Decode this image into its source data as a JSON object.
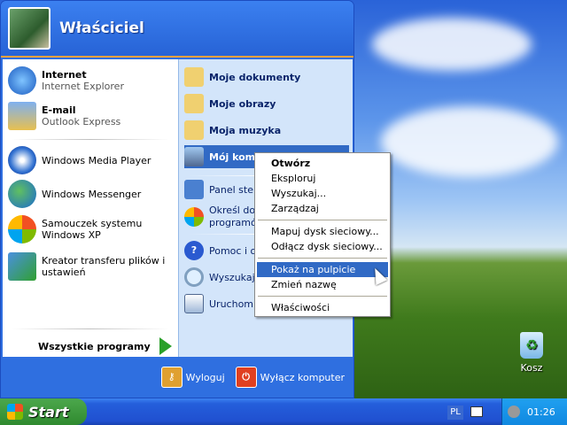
{
  "user": {
    "name": "Właściciel"
  },
  "left": [
    {
      "title": "Internet",
      "sub": "Internet Explorer",
      "icon": "internet-explorer-icon"
    },
    {
      "title": "E-mail",
      "sub": "Outlook Express",
      "icon": "outlook-express-icon"
    },
    {
      "label": "Windows Media Player",
      "icon": "media-player-icon"
    },
    {
      "label": "Windows Messenger",
      "icon": "messenger-icon"
    },
    {
      "label": "Samouczek systemu Windows XP",
      "icon": "tour-icon"
    },
    {
      "label": "Kreator transferu plików i ustawień",
      "icon": "transfer-wizard-icon"
    }
  ],
  "all_programs": "Wszystkie programy",
  "right": [
    {
      "label": "Moje dokumenty",
      "icon": "folder-icon"
    },
    {
      "label": "Moje obrazy",
      "icon": "folder-icon"
    },
    {
      "label": "Moja muzyka",
      "icon": "folder-icon"
    },
    {
      "label": "Mój komputer",
      "icon": "computer-icon"
    },
    {
      "label": "Panel sterowania",
      "icon": "control-panel-icon"
    },
    {
      "label": "Określ dostęp do programów i ich ustawienia",
      "icon": "program-access-icon"
    },
    {
      "label": "Pomoc i obsługa techniczna",
      "icon": "help-icon"
    },
    {
      "label": "Wyszukaj",
      "icon": "search-icon"
    },
    {
      "label": "Uruchom...",
      "icon": "run-icon"
    }
  ],
  "footer": {
    "logoff": "Wyloguj",
    "shutdown": "Wyłącz komputer"
  },
  "context_menu": [
    "Otwórz",
    "Eksploruj",
    "Wyszukaj...",
    "Zarządzaj",
    "Mapuj dysk sieciowy...",
    "Odłącz dysk sieciowy...",
    "Pokaż na pulpicie",
    "Zmień nazwę",
    "Właściwości"
  ],
  "desktop": {
    "recycle_bin": "Kosz"
  },
  "taskbar": {
    "start": "Start",
    "lang": "PL",
    "clock": "01:26"
  },
  "colors": {
    "highlight": "#316ac5",
    "start_green": "#2f8a2f",
    "taskbar_blue": "#245edb"
  }
}
